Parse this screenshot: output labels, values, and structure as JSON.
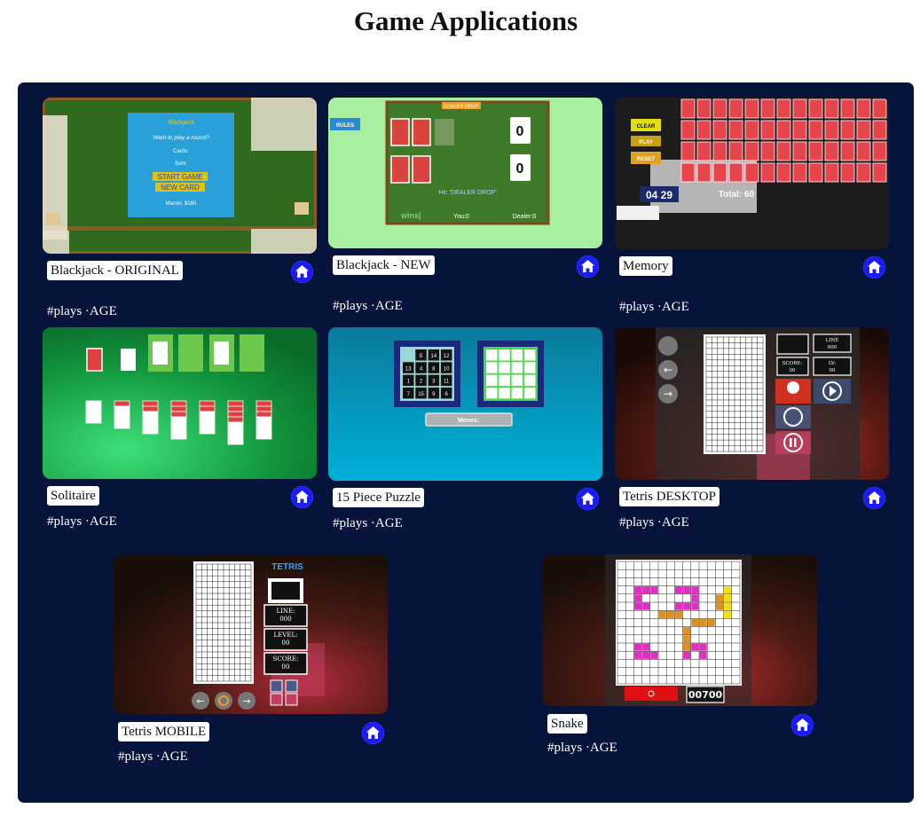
{
  "page": {
    "title": "Game Applications"
  },
  "games": [
    {
      "name": "Blackjack - ORIGINAL",
      "meta": "#plays ·AGE",
      "thumb": {
        "title": "Blackjack",
        "prompt": "Want to play a round?",
        "cards": "Cards:",
        "sum": "Sum:",
        "start": "START GAME",
        "new": "NEW CARD",
        "player": "Marvin: $180"
      }
    },
    {
      "name": "Blackjack - NEW",
      "meta": "#plays ·AGE",
      "thumb": {
        "rules": "RULES",
        "banner": "DEALER DROP",
        "score1": "0",
        "score2": "0",
        "hint": "Hit: 'DEALER DROP'",
        "wins": "wins|",
        "you": "You:0",
        "dealer": "Dealer:0"
      }
    },
    {
      "name": "Memory",
      "meta": "#plays ·AGE",
      "thumb": {
        "clear": "CLEAR",
        "play": "PLAY",
        "reset": "RESET",
        "time": "04 29",
        "total": "Total: 60"
      }
    },
    {
      "name": "Solitaire",
      "meta": "#plays ·AGE"
    },
    {
      "name": "15 Piece Puzzle",
      "meta": "#plays ·AGE",
      "thumb": {
        "tiles": [
          "",
          "5",
          "14",
          "12",
          "13",
          "4",
          "8",
          "10",
          "1",
          "2",
          "3",
          "11",
          "7",
          "15",
          "9",
          "6"
        ],
        "moves": "Moves:"
      }
    },
    {
      "name": "Tetris DESKTOP",
      "meta": "#plays ·AGE",
      "thumb": {
        "line": "LINE",
        "line_val": "000",
        "score": "SCORE:",
        "score_val": "00",
        "lv": "LV:",
        "lv_val": "00"
      }
    },
    {
      "name": "Tetris MOBILE",
      "meta": "#plays ·AGE",
      "thumb": {
        "logo": "TETRIS",
        "line": "LINE:",
        "line_val": "000",
        "level": "LEVEL:",
        "level_val": "00",
        "score": "SCORE:",
        "score_val": "00"
      }
    },
    {
      "name": "Snake",
      "meta": "#plays ·AGE",
      "thumb": {
        "score": "00700"
      }
    }
  ],
  "colors": {
    "panel": "#06133a",
    "home": "#1a1aff"
  }
}
